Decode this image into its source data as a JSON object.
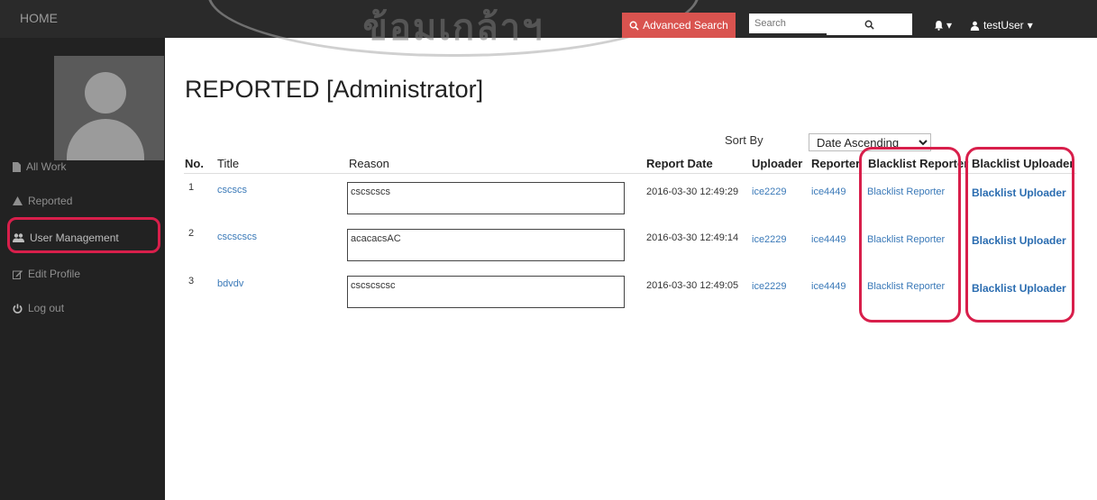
{
  "topbar": {
    "brand": "HOME",
    "watermark": "ข้อมเกล้าฯ",
    "advanced_search_label": "Advanced Search",
    "search_placeholder": "Search",
    "user_label": "testUser",
    "bell_caret": "▾",
    "user_caret": "▾"
  },
  "sidebar": {
    "items": [
      {
        "label": "All Work",
        "icon": "file-icon"
      },
      {
        "label": "Reported",
        "icon": "warning-icon"
      },
      {
        "label": "User Management",
        "icon": "users-icon"
      },
      {
        "label": "Edit Profile",
        "icon": "edit-icon"
      },
      {
        "label": "Log out",
        "icon": "power-icon"
      }
    ]
  },
  "main": {
    "title": "REPORTED [Administrator]",
    "sort_by_label": "Sort By",
    "sort_selected": "Date Ascending",
    "columns": [
      "No.",
      "Title",
      "Reason",
      "Report Date",
      "Uploader",
      "Reporter",
      "Blacklist Reporter",
      "Blacklist Uploader"
    ],
    "rows": [
      {
        "no": "1",
        "title": "cscscs",
        "reason": "cscscscs",
        "report_date": "2016-03-30 12:49:29",
        "uploader": "ice2229",
        "reporter": "ice4449",
        "blacklist_reporter": "Blacklist Reporter",
        "blacklist_uploader": "Blacklist Uploader"
      },
      {
        "no": "2",
        "title": "cscscscs",
        "reason": "acacacsAC",
        "report_date": "2016-03-30 12:49:14",
        "uploader": "ice2229",
        "reporter": "ice4449",
        "blacklist_reporter": "Blacklist Reporter",
        "blacklist_uploader": "Blacklist Uploader"
      },
      {
        "no": "3",
        "title": "bdvdv",
        "reason": "cscscscsc",
        "report_date": "2016-03-30 12:49:05",
        "uploader": "ice2229",
        "reporter": "ice4449",
        "blacklist_reporter": "Blacklist Reporter",
        "blacklist_uploader": "Blacklist Uploader"
      }
    ]
  },
  "colors": {
    "accent": "#d9534f",
    "highlight": "#d81f4b",
    "link": "#3a79b8",
    "sidebar_bg": "#222222",
    "topbar_bg": "#2a2a2a"
  }
}
